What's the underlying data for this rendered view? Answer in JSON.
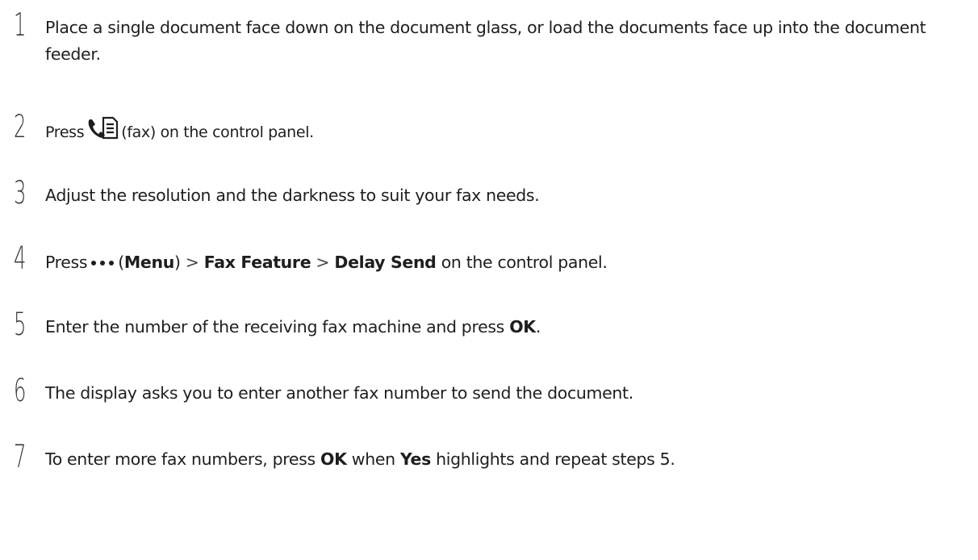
{
  "steps": [
    {
      "number": "1",
      "text": "Place a single document face down on the document glass, or load the documents face up into the document feeder."
    },
    {
      "number": "2",
      "press": "Press",
      "icon": "fax-icon",
      "after": "(fax) on the control panel."
    },
    {
      "number": "3",
      "text": "Adjust the resolution and the darkness to suit your fax needs."
    },
    {
      "number": "4",
      "press": "Press",
      "icon": "menu-dots-icon",
      "paren_open": "(",
      "menu": "Menu",
      "paren_close": ")",
      "sep": ">",
      "fax_feature": "Fax Feature",
      "delay_send": "Delay Send",
      "after": "on the control panel."
    },
    {
      "number": "5",
      "before": "Enter the number of the receiving fax machine and press",
      "ok": "OK",
      "after": "."
    },
    {
      "number": "6",
      "text": "The display asks you to enter another fax number to send the document."
    },
    {
      "number": "7",
      "before": "To enter more fax numbers, press",
      "ok": "OK",
      "middle": "when",
      "yes": "Yes",
      "after": "highlights and repeat steps 5."
    }
  ]
}
